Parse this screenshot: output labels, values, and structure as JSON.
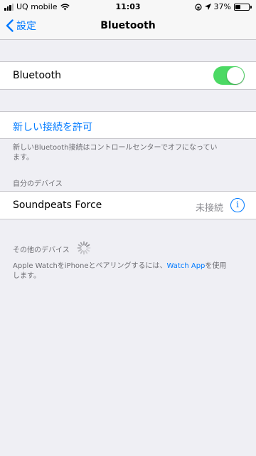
{
  "status_bar": {
    "carrier": "UQ mobile",
    "time": "11:03",
    "battery_percent": "37%",
    "battery_level": 0.37,
    "icons": [
      "signal-icon",
      "wifi-icon",
      "screen-lock-icon",
      "location-icon",
      "battery-icon"
    ]
  },
  "nav": {
    "back_label": "設定",
    "title": "Bluetooth"
  },
  "bluetooth_toggle": {
    "label": "Bluetooth",
    "on": true,
    "color": "#4cd964"
  },
  "connection": {
    "allow_label": "新しい接続を許可",
    "footer_line1": "新しいBluetooth接続はコントロールセンターでオフになってい",
    "footer_line2": "ます。"
  },
  "my_devices": {
    "header": "自分のデバイス",
    "devices": [
      {
        "name": "Soundpeats Force",
        "status": "未接続",
        "info": "i"
      }
    ]
  },
  "other_devices": {
    "header": "その他のデバイス",
    "footer_prefix": "Apple WatchをiPhoneとペアリングするには、",
    "footer_link": "Watch App",
    "footer_suffix": "を使用",
    "footer_line2": "します。"
  },
  "colors": {
    "accent": "#007aff",
    "background": "#efeff4",
    "toggle_on": "#4cd964"
  }
}
